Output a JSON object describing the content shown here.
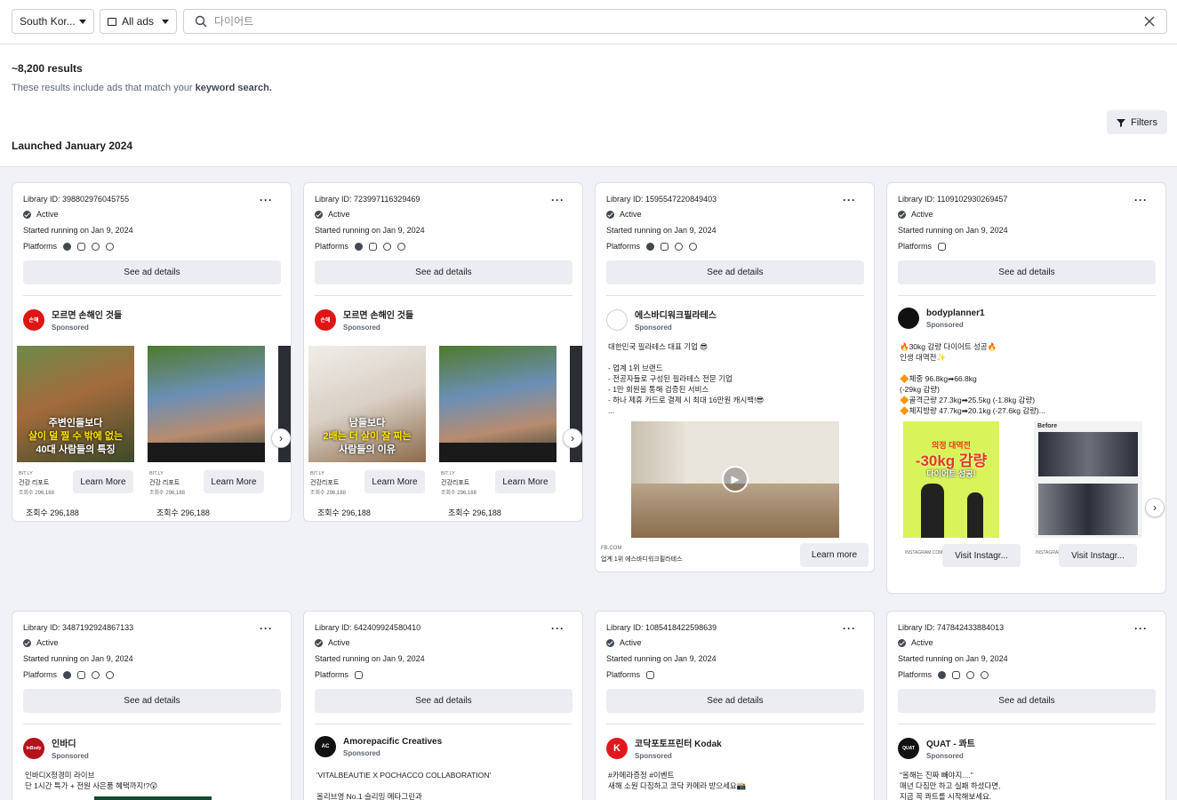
{
  "search": {
    "country": "South Kor...",
    "ad_type": "All ads",
    "query": "",
    "placeholder": "다이어트"
  },
  "summary": {
    "count": "~8,200 results",
    "note_prefix": "These results include ads that match your ",
    "note_bold": "keyword search."
  },
  "filters_label": "Filters",
  "section_title": "Launched January 2024",
  "common": {
    "active": "Active",
    "platforms": "Platforms",
    "see_details": "See ad details",
    "sponsored": "Sponsored",
    "more": "···"
  },
  "cards": [
    {
      "library_id": "Library ID: 398802976045755",
      "started": "Started running on Jan 9, 2024",
      "advertiser": "모르면 손해인 것들",
      "avatar_text": "손해",
      "slides": [
        {
          "cap1": "주변인들보다",
          "cap2": "살이 덜 찔 수 밖에 없는",
          "cap3": "40대 사람들의 특징",
          "domain": "BIT.LY",
          "sub": "건강 리포트",
          "views_small": "조회수 296,188",
          "cta": "Learn More",
          "views": "조회수 296,188"
        },
        {
          "cap1": "",
          "cap2": "",
          "cap3": "",
          "domain": "BIT.LY",
          "sub": "건강 리포트",
          "views_small": "조회수 296,188",
          "cta": "Learn More",
          "views": "조회수 296,188"
        }
      ]
    },
    {
      "library_id": "Library ID: 723997116329469",
      "started": "Started running on Jan 9, 2024",
      "advertiser": "모르면 손해인 것들",
      "avatar_text": "손해",
      "slides": [
        {
          "cap1": "남들보다",
          "cap2": "2배는 더 살이 잘 찌는",
          "cap3": "사람들의 이유",
          "domain": "BIT.LY",
          "sub": "건강리포트",
          "views_small": "조회수 296,188",
          "cta": "Learn More",
          "views": "조회수 296,188"
        },
        {
          "cap1": "",
          "cap2": "",
          "cap3": "",
          "domain": "BIT.LY",
          "sub": "건강리포트",
          "views_small": "조회수 296,188",
          "cta": "Learn More",
          "views": "조회수 296,188"
        }
      ]
    },
    {
      "library_id": "Library ID: 1595547220849403",
      "started": "Started running on Jan 9, 2024",
      "advertiser": "에스바디워크필라테스",
      "body": "대한민국 필라테스 대표 기업 😎\n\n- 업계 1위 브랜드\n- 전공자들로 구성된 필라테스 전문 기업\n- 1만 회원을 통해 검증된 서비스\n- 하나 제휴 카드로 결제 시 최대 16만원 캐시백!😎\n...",
      "domain": "FB.COM",
      "sub": "업계 1위 에스바디워크필라테스",
      "cta": "Learn more"
    },
    {
      "library_id": "Library ID: 1109102930269457",
      "started": "Started running on Jan 9, 2024",
      "advertiser": "bodyplanner1",
      "body": "🔥30kg 감량 다이어트 성공🔥\n인생 대역전✨\n\n🔶체중 96.8kg➡66.8kg\n(-29kg 감량)\n🔶골격근량 27.3kg➡25.5kg (-1.8kg 감량)\n🔶체지방량 47.7kg➡20.1kg (-27.6kg 감량)...",
      "slides": [
        {
          "cap1": "의정 대역전",
          "cap2": "-30kg 감량",
          "cap3": "다이어트 성공!",
          "domain": "INSTAGRAM.COM",
          "cta": "Visit Instagr..."
        },
        {
          "cap1": "Before",
          "cap2": "",
          "cap3": "",
          "domain": "INSTAGRAM.COM",
          "cta": "Visit Instagr..."
        }
      ]
    },
    {
      "library_id": "Library ID: 3487192924867133",
      "started": "Started running on Jan 9, 2024",
      "advertiser": "인바디",
      "avatar_text": "InBody",
      "body": "인바디X정경미 라이브\n단 1시간 특가 + 전원 사은품 혜택까지!?😲"
    },
    {
      "library_id": "Library ID: 642409924580410",
      "started": "Started running on Jan 9, 2024",
      "advertiser": "Amorepacific Creatives",
      "avatar_text": "AC",
      "body": "'VITALBEAUTIE X POCHACCO COLLABORATION'\n\n올리브영 No.1 슬리밍 메타그린과"
    },
    {
      "library_id": "Library ID: 1085418422598639",
      "started": "Started running on Jan 9, 2024",
      "advertiser": "코닥포토프린터 Kodak",
      "avatar_text": "K",
      "body": "#카메라증정 #이벤트\n새해 소원 다짐하고 코닥 카메라 받으세요📸"
    },
    {
      "library_id": "Library ID: 747842433884013",
      "started": "Started running on Jan 9, 2024",
      "advertiser": "QUAT - 콰트",
      "avatar_text": "QUAT",
      "body": "\"올해는 진짜 빼야지....\"\n매년 다짐만 하고 실패 하셨다면,\n지금 꼭 콰트를 시작해보세요."
    }
  ]
}
